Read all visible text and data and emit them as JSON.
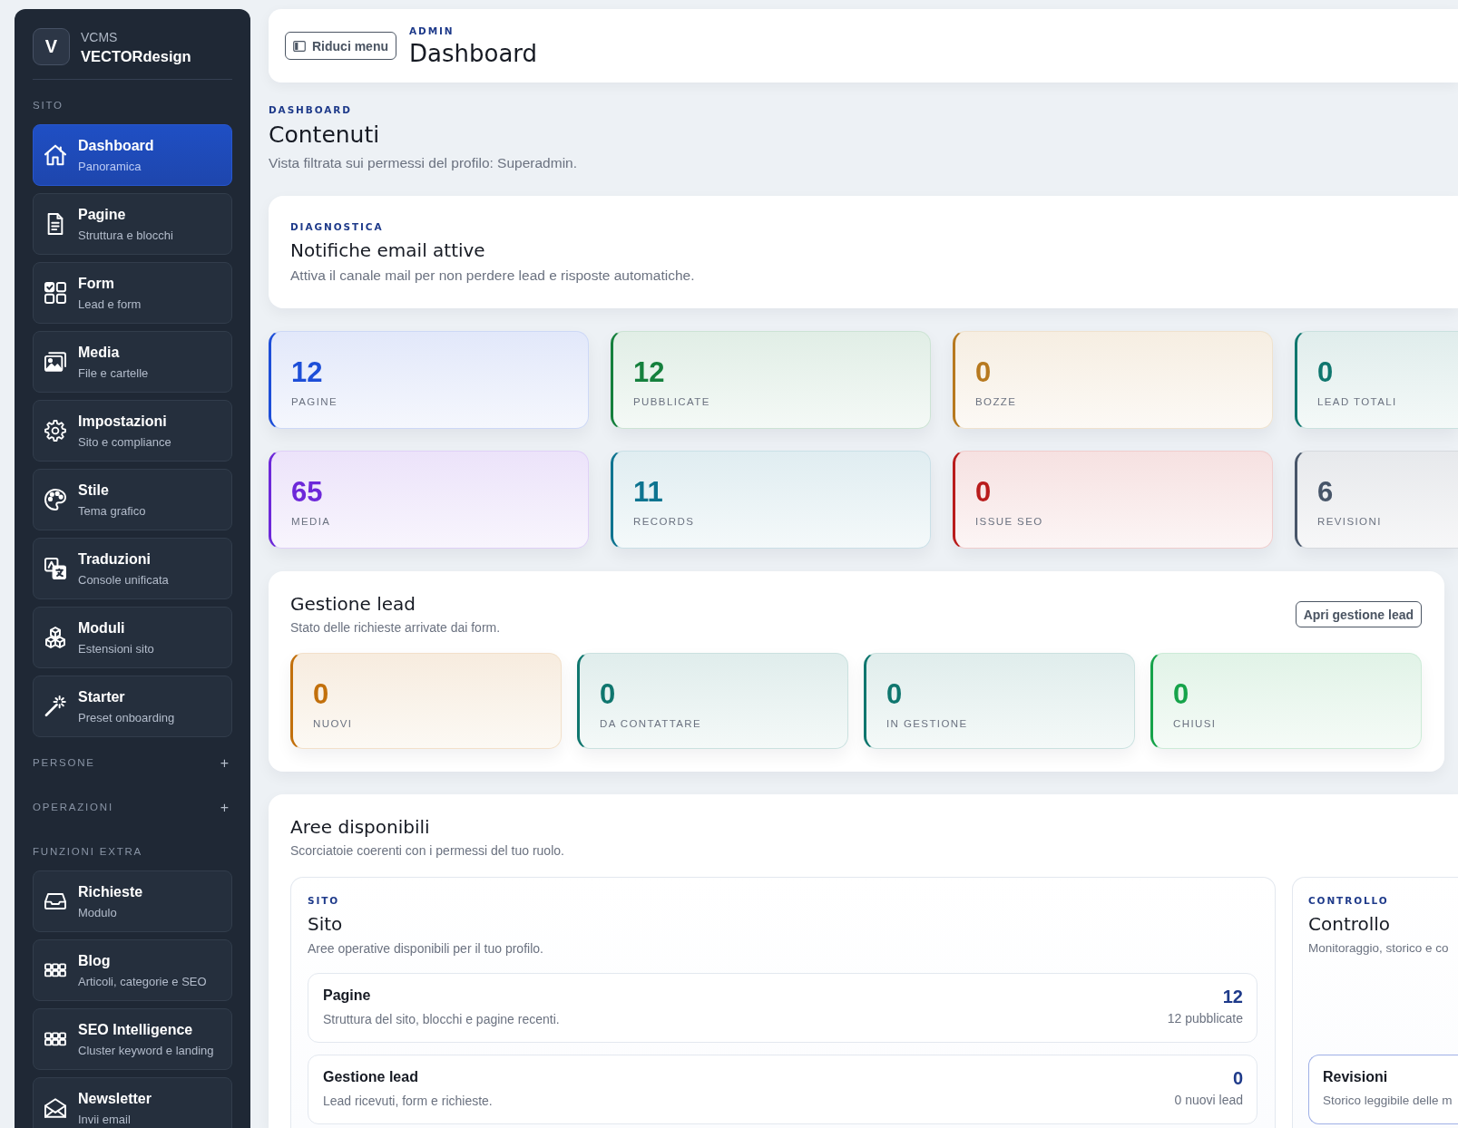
{
  "sidebar": {
    "brand": {
      "logo": "V",
      "name": "VCMS",
      "title": "VECTORdesign"
    },
    "sections": [
      {
        "label": "SITO",
        "items": [
          {
            "title": "Dashboard",
            "subtitle": "Panoramica",
            "selected": true
          },
          {
            "title": "Pagine",
            "subtitle": "Struttura e blocchi",
            "selected": false
          },
          {
            "title": "Form",
            "subtitle": "Lead e form",
            "selected": false
          },
          {
            "title": "Media",
            "subtitle": "File e cartelle",
            "selected": false
          },
          {
            "title": "Impostazioni",
            "subtitle": "Sito e compliance",
            "selected": false
          },
          {
            "title": "Stile",
            "subtitle": "Tema grafico",
            "selected": false
          },
          {
            "title": "Traduzioni",
            "subtitle": "Console unificata",
            "selected": false
          },
          {
            "title": "Moduli",
            "subtitle": "Estensioni sito",
            "selected": false
          },
          {
            "title": "Starter",
            "subtitle": "Preset onboarding",
            "selected": false
          }
        ]
      },
      {
        "label": "PERSONE",
        "toggle": "+"
      },
      {
        "label": "OPERAZIONI",
        "toggle": "+"
      },
      {
        "label": "FUNZIONI EXTRA",
        "items": [
          {
            "title": "Richieste",
            "subtitle": "Modulo",
            "selected": false
          },
          {
            "title": "Blog",
            "subtitle": "Articoli, categorie e SEO",
            "selected": false
          },
          {
            "title": "SEO Intelligence",
            "subtitle": "Cluster keyword e landing",
            "selected": false
          },
          {
            "title": "Newsletter",
            "subtitle": "Invii email",
            "selected": false
          }
        ]
      }
    ]
  },
  "header": {
    "button": "Riduci menu",
    "eyebrow": "ADMIN",
    "title": "Dashboard"
  },
  "intro": {
    "eyebrow": "DASHBOARD",
    "title": "Contenuti",
    "subtitle": "Vista filtrata sui permessi del profilo: Superadmin."
  },
  "notice": {
    "eyebrow": "DIAGNOSTICA",
    "title": "Notifiche email attive",
    "text": "Attiva il canale mail per non perdere lead e risposte automatiche."
  },
  "stats": [
    {
      "value": "12",
      "label": "PAGINE",
      "color": "#1d4ed8"
    },
    {
      "value": "12",
      "label": "PUBBLICATE",
      "color": "#15803d"
    },
    {
      "value": "0",
      "label": "BOZZE",
      "color": "#b7791f"
    },
    {
      "value": "0",
      "label": "LEAD TOTALI",
      "color": "#0f766e"
    },
    {
      "value": "65",
      "label": "MEDIA",
      "color": "#6d28d9"
    },
    {
      "value": "11",
      "label": "RECORDS",
      "color": "#0e7490"
    },
    {
      "value": "0",
      "label": "ISSUE SEO",
      "color": "#b91c1c"
    },
    {
      "value": "6",
      "label": "REVISIONI",
      "color": "#475569"
    }
  ],
  "leads": {
    "title": "Gestione lead",
    "subtitle": "Stato delle richieste arrivate dai form.",
    "button": "Apri gestione lead",
    "stats": [
      {
        "value": "0",
        "label": "NUOVI",
        "color": "#c2700c"
      },
      {
        "value": "0",
        "label": "DA CONTATTARE",
        "color": "#0f766e"
      },
      {
        "value": "0",
        "label": "IN GESTIONE",
        "color": "#0f766e"
      },
      {
        "value": "0",
        "label": "CHIUSI",
        "color": "#16a34a"
      }
    ]
  },
  "areas": {
    "title": "Aree disponibili",
    "subtitle": "Scorciatoie coerenti con i permessi del tuo ruolo.",
    "panels": [
      {
        "eyebrow": "SITO",
        "title": "Sito",
        "subtitle": "Aree operative disponibili per il tuo profilo.",
        "rows": [
          {
            "title": "Pagine",
            "text": "Struttura del sito, blocchi e pagine recenti.",
            "value": "12",
            "note": "12 pubblicate",
            "highlighted": false
          },
          {
            "title": "Gestione lead",
            "text": "Lead ricevuti, form e richieste.",
            "value": "0",
            "note": "0 nuovi lead",
            "highlighted": false
          }
        ]
      },
      {
        "eyebrow": "CONTROLLO",
        "title": "Controllo",
        "subtitle": "Monitoraggio, storico e co",
        "rows": [
          {
            "title": "Revisioni",
            "text": "Storico leggibile delle m",
            "highlighted": true
          }
        ]
      }
    ]
  }
}
